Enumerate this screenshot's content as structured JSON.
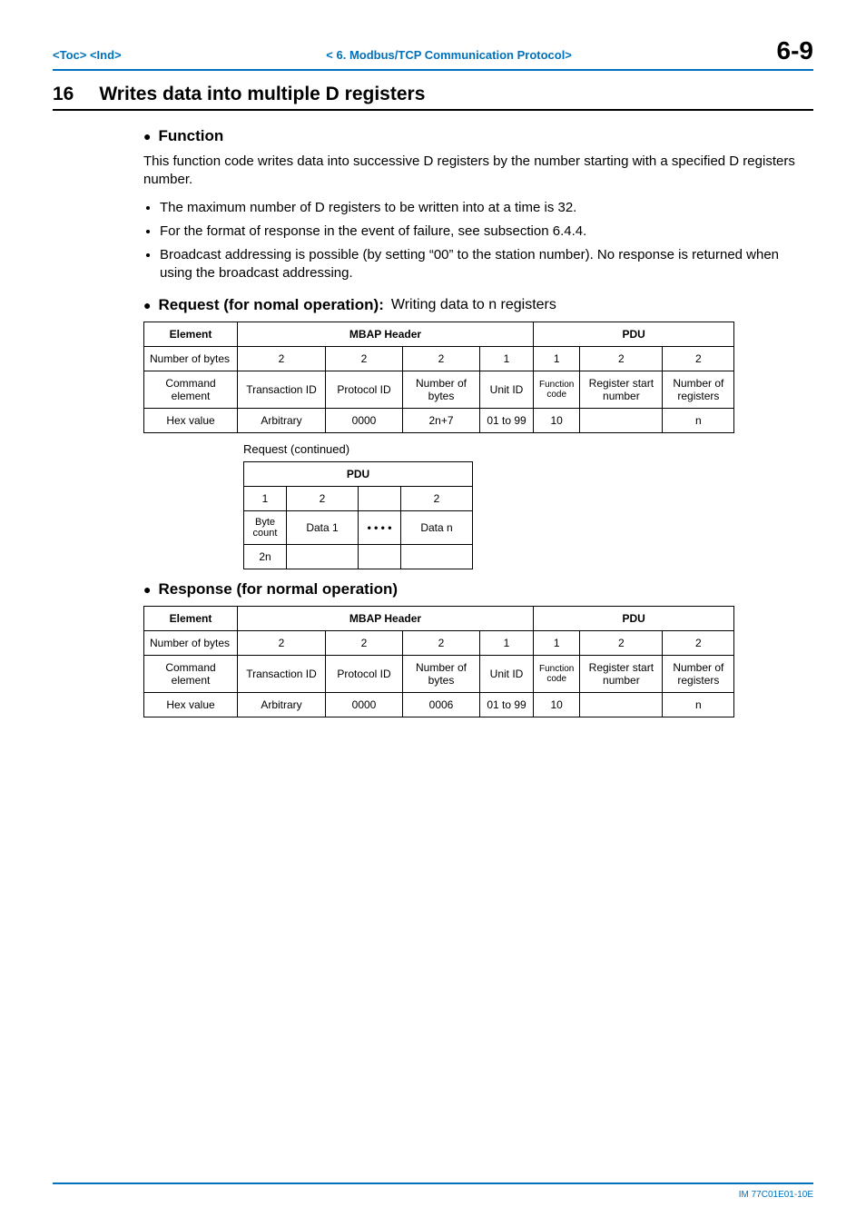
{
  "header": {
    "toc": "<Toc>",
    "ind": "<Ind>",
    "chapter": "< 6.   Modbus/TCP Communication Protocol>",
    "page_number": "6-9"
  },
  "title": {
    "number": "16",
    "text": "Writes data into multiple D registers"
  },
  "function": {
    "heading": "Function",
    "para": "This function code writes data into successive D registers by the number starting with a specified D registers number.",
    "bullets": [
      "The maximum number of D registers to be written into at a time is 32.",
      "For the format of response in the event of failure, see subsection 6.4.4.",
      "Broadcast addressing is possible (by setting “00” to the station number). No response is returned when using the broadcast addressing."
    ]
  },
  "request": {
    "heading": "Request (for nomal operation):",
    "note": "Writing data to n registers",
    "table": {
      "group_mbap": "MBAP Header",
      "group_pdu": "PDU",
      "rows": {
        "element": "Element",
        "nbytes_label": "Number of bytes",
        "nbytes": [
          "2",
          "2",
          "2",
          "1",
          "1",
          "2",
          "2"
        ],
        "cmd_label": "Command element",
        "cmd": [
          "Transaction ID",
          "Protocol ID",
          "Number of bytes",
          "Unit ID",
          "Function code",
          "Register start number",
          "Number of registers"
        ],
        "hex_label": "Hex value",
        "hex": [
          "Arbitrary",
          "0000",
          "2n+7",
          "01 to 99",
          "10",
          "",
          "n"
        ]
      }
    },
    "continued_caption": "Request (continued)",
    "table2": {
      "group_pdu": "PDU",
      "nbytes": [
        "1",
        "2",
        "",
        "2"
      ],
      "cmd": [
        "Byte count",
        "Data 1",
        "• • • •",
        "Data n"
      ],
      "hex": [
        "2n",
        "",
        "",
        ""
      ]
    }
  },
  "response": {
    "heading": "Response (for normal operation)",
    "table": {
      "group_mbap": "MBAP Header",
      "group_pdu": "PDU",
      "rows": {
        "element": "Element",
        "nbytes_label": "Number of bytes",
        "nbytes": [
          "2",
          "2",
          "2",
          "1",
          "1",
          "2",
          "2"
        ],
        "cmd_label": "Command element",
        "cmd": [
          "Transaction ID",
          "Protocol ID",
          "Number of bytes",
          "Unit ID",
          "Function code",
          "Register start number",
          "Number of registers"
        ],
        "hex_label": "Hex value",
        "hex": [
          "Arbitrary",
          "0000",
          "0006",
          "01 to 99",
          "10",
          "",
          "n"
        ]
      }
    }
  },
  "footer": {
    "docid": "IM 77C01E01-10E"
  }
}
